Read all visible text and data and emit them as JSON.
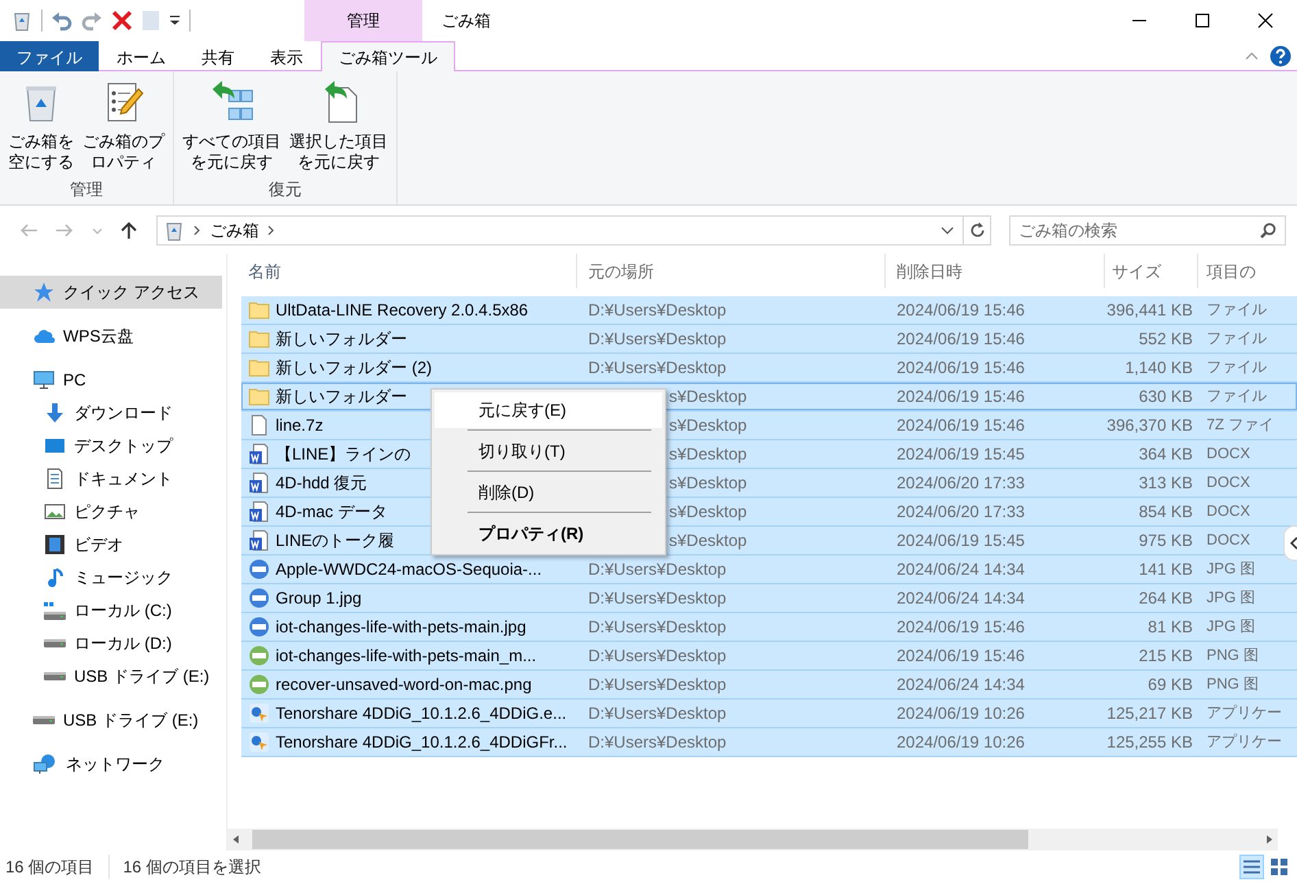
{
  "window": {
    "title": "ごみ箱",
    "context_group": "管理"
  },
  "ribbon_tabs": [
    {
      "label": "ファイル",
      "kind": "file",
      "selected": false
    },
    {
      "label": "ホーム",
      "kind": "tab",
      "selected": false
    },
    {
      "label": "共有",
      "kind": "tab",
      "selected": false
    },
    {
      "label": "表示",
      "kind": "tab",
      "selected": false
    },
    {
      "label": "ごみ箱ツール",
      "kind": "contextual",
      "selected": true
    }
  ],
  "ribbon_groups": [
    {
      "label": "管理",
      "buttons": [
        {
          "label": "ごみ箱を空にする",
          "kind": "empty-bin"
        },
        {
          "label": "ごみ箱のプロパティ",
          "kind": "properties"
        }
      ]
    },
    {
      "label": "復元",
      "buttons": [
        {
          "label": "すべての項目を元に戻す",
          "kind": "restore-all"
        },
        {
          "label": "選択した項目を元に戻す",
          "kind": "restore-selected"
        }
      ]
    }
  ],
  "address": {
    "path": [
      "ごみ箱"
    ]
  },
  "search": {
    "placeholder": "ごみ箱の検索"
  },
  "nav": [
    {
      "label": "クイック アクセス",
      "kind": "star",
      "selected": true
    },
    {
      "label": "WPS云盘",
      "kind": "cloud",
      "selected": false
    },
    {
      "label": "PC",
      "kind": "pc",
      "selected": false,
      "children": [
        {
          "label": "ダウンロード",
          "kind": "download",
          "selected": false
        },
        {
          "label": "デスクトップ",
          "kind": "desktop",
          "selected": false
        },
        {
          "label": "ドキュメント",
          "kind": "document",
          "selected": false
        },
        {
          "label": "ピクチャ",
          "kind": "picture",
          "selected": false
        },
        {
          "label": "ビデオ",
          "kind": "video",
          "selected": false
        },
        {
          "label": "ミュージック",
          "kind": "music",
          "selected": false
        },
        {
          "label": "ローカル (C:)",
          "kind": "system-drive",
          "selected": false
        },
        {
          "label": "ローカル (D:)",
          "kind": "drive",
          "selected": false
        },
        {
          "label": "USB ドライブ (E:)",
          "kind": "drive",
          "selected": false
        }
      ]
    },
    {
      "label": "USB ドライブ (E:)",
      "kind": "drive",
      "selected": false
    },
    {
      "label": "ネットワーク",
      "kind": "network",
      "selected": false
    }
  ],
  "table": {
    "columns": [
      "名前",
      "元の場所",
      "削除日時",
      "サイズ",
      "項目の"
    ],
    "rows": [
      {
        "name": "UltData-LINE Recovery 2.0.4.5x86",
        "location": "D:¥Users¥Desktop",
        "deleted": "2024/06/19 15:46",
        "size": "396,441 KB",
        "type": "ファイル",
        "kind": "folder",
        "selected": true,
        "focused": false
      },
      {
        "name": "新しいフォルダー",
        "location": "D:¥Users¥Desktop",
        "deleted": "2024/06/19 15:46",
        "size": "552 KB",
        "type": "ファイル",
        "kind": "folder",
        "selected": true,
        "focused": false
      },
      {
        "name": "新しいフォルダー (2)",
        "location": "D:¥Users¥Desktop",
        "deleted": "2024/06/19 15:46",
        "size": "1,140 KB",
        "type": "ファイル",
        "kind": "folder",
        "selected": true,
        "focused": false
      },
      {
        "name": "新しいフォルダー",
        "location": "s¥Desktop",
        "deleted": "2024/06/19 15:46",
        "size": "630 KB",
        "type": "ファイル",
        "kind": "folder",
        "selected": true,
        "focused": true
      },
      {
        "name": "line.7z",
        "location": "s¥Desktop",
        "deleted": "2024/06/19 15:46",
        "size": "396,370 KB",
        "type": "7Z ファイ",
        "kind": "file",
        "selected": true,
        "focused": false
      },
      {
        "name": "【LINE】ラインの",
        "location": "s¥Desktop",
        "deleted": "2024/06/19 15:45",
        "size": "364 KB",
        "type": "DOCX",
        "kind": "word",
        "selected": true,
        "focused": false
      },
      {
        "name": "4D-hdd 復元",
        "location": "s¥Desktop",
        "deleted": "2024/06/20 17:33",
        "size": "313 KB",
        "type": "DOCX",
        "kind": "word",
        "selected": true,
        "focused": false
      },
      {
        "name": "4D-mac データ",
        "location": "s¥Desktop",
        "deleted": "2024/06/20 17:33",
        "size": "854 KB",
        "type": "DOCX",
        "kind": "word",
        "selected": true,
        "focused": false
      },
      {
        "name": "LINEのトーク履",
        "location": "s¥Desktop",
        "deleted": "2024/06/19 15:45",
        "size": "975 KB",
        "type": "DOCX",
        "kind": "word",
        "selected": true,
        "focused": false
      },
      {
        "name": "Apple-WWDC24-macOS-Sequoia-...",
        "location": "D:¥Users¥Desktop",
        "deleted": "2024/06/24 14:34",
        "size": "141 KB",
        "type": "JPG 图",
        "kind": "jpg",
        "selected": true,
        "focused": false
      },
      {
        "name": "Group 1.jpg",
        "location": "D:¥Users¥Desktop",
        "deleted": "2024/06/24 14:34",
        "size": "264 KB",
        "type": "JPG 图",
        "kind": "jpg",
        "selected": true,
        "focused": false
      },
      {
        "name": "iot-changes-life-with-pets-main.jpg",
        "location": "D:¥Users¥Desktop",
        "deleted": "2024/06/19 15:46",
        "size": "81 KB",
        "type": "JPG 图",
        "kind": "jpg",
        "selected": true,
        "focused": false
      },
      {
        "name": "iot-changes-life-with-pets-main_m...",
        "location": "D:¥Users¥Desktop",
        "deleted": "2024/06/19 15:46",
        "size": "215 KB",
        "type": "PNG 图",
        "kind": "png",
        "selected": true,
        "focused": false
      },
      {
        "name": "recover-unsaved-word-on-mac.png",
        "location": "D:¥Users¥Desktop",
        "deleted": "2024/06/24 14:34",
        "size": "69 KB",
        "type": "PNG 图",
        "kind": "png",
        "selected": true,
        "focused": false
      },
      {
        "name": "Tenorshare 4DDiG_10.1.2.6_4DDiG.e...",
        "location": "D:¥Users¥Desktop",
        "deleted": "2024/06/19 10:26",
        "size": "125,217 KB",
        "type": "アプリケー",
        "kind": "app",
        "selected": true,
        "focused": false
      },
      {
        "name": "Tenorshare 4DDiG_10.1.2.6_4DDiGFr...",
        "location": "D:¥Users¥Desktop",
        "deleted": "2024/06/19 10:26",
        "size": "125,255 KB",
        "type": "アプリケー",
        "kind": "app",
        "selected": true,
        "focused": false
      }
    ]
  },
  "context_menu": [
    {
      "label": "元に戻す(E)",
      "selected": true,
      "default": false
    },
    {
      "label": "切り取り(T)",
      "selected": false,
      "default": false
    },
    {
      "label": "削除(D)",
      "selected": false,
      "default": false
    },
    {
      "label": "プロパティ(R)",
      "selected": false,
      "default": true
    }
  ],
  "status_bar": {
    "item_count": "16 個の項目",
    "selection": "16 個の項目を選択"
  },
  "views": [
    {
      "kind": "details",
      "selected": true
    },
    {
      "kind": "large-icons",
      "selected": false
    }
  ]
}
